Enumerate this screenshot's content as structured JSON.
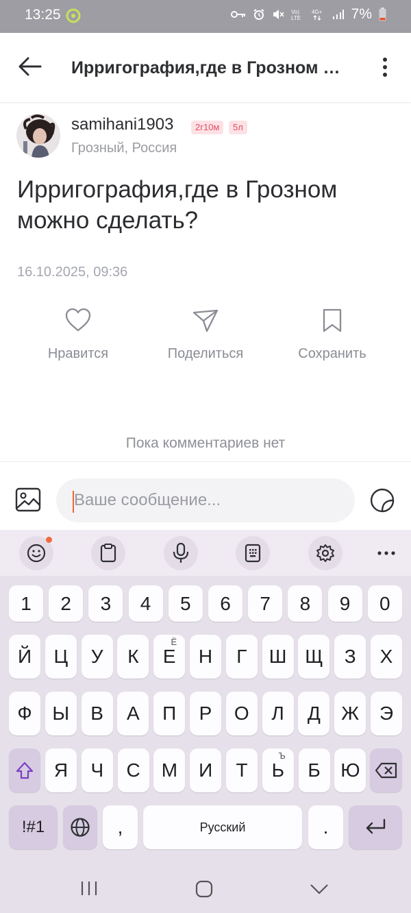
{
  "status": {
    "time": "13:25",
    "battery": "7%"
  },
  "header": {
    "title": "Ирригография,где в Грозном можно сделать?"
  },
  "post": {
    "username": "samihani1903",
    "badges": [
      "2г10м",
      "5л"
    ],
    "location": "Грозный, Россия",
    "text": "Ирригография,где в Грозном можно сделать?",
    "date": "16.10.2025, 09:36"
  },
  "actions": {
    "like": "Нравится",
    "share": "Поделиться",
    "save": "Сохранить"
  },
  "comments": {
    "empty_text": "Пока комментариев нет"
  },
  "composer": {
    "placeholder": "Ваше сообщение..."
  },
  "keyboard": {
    "rows": [
      [
        "1",
        "2",
        "3",
        "4",
        "5",
        "6",
        "7",
        "8",
        "9",
        "0"
      ],
      [
        "Й",
        "Ц",
        "У",
        "К",
        "Е",
        "Н",
        "Г",
        "Ш",
        "Щ",
        "З",
        "Х"
      ],
      [
        "Ф",
        "Ы",
        "В",
        "А",
        "П",
        "Р",
        "О",
        "Л",
        "Д",
        "Ж",
        "Э"
      ],
      [
        "Я",
        "Ч",
        "С",
        "М",
        "И",
        "Т",
        "Ь",
        "Б",
        "Ю"
      ]
    ],
    "hints": {
      "Е": "Ё",
      "Ь": "Ъ"
    },
    "symbols_label": "!#1",
    "comma": ",",
    "space_label": "Русский",
    "period": "."
  },
  "colors": {
    "status_bar": "#9d9da3",
    "keyboard_bg": "#e6e0ea",
    "badge_text": "#e05065",
    "caret": "#e8682d"
  }
}
